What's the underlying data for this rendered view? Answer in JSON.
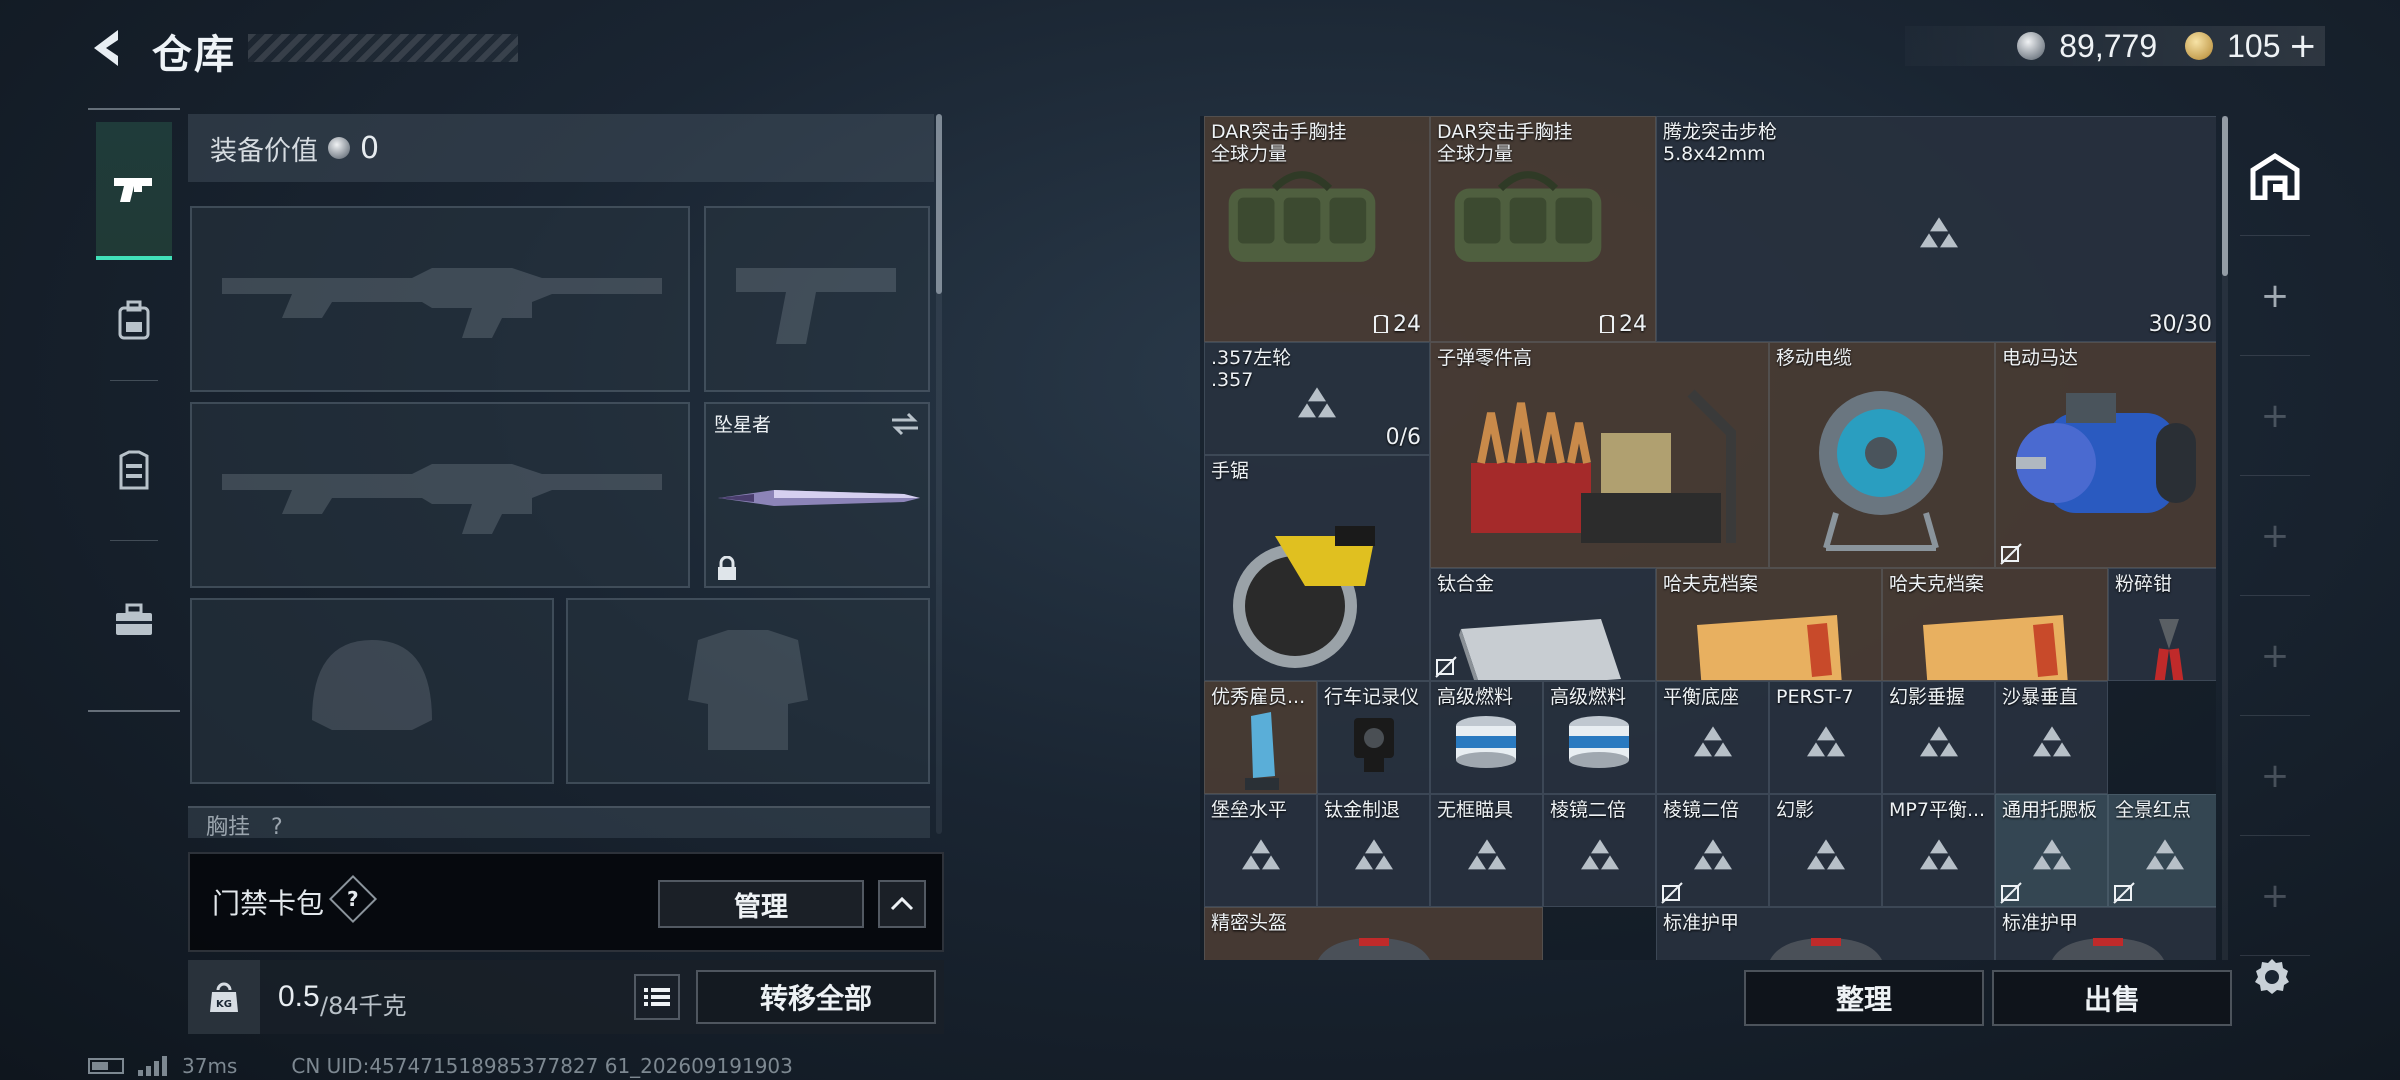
{
  "header": {
    "title": "仓库",
    "back_icon": "back-arrow-icon",
    "currency_silver": "89,779",
    "currency_gold": "105",
    "currency_plus": "+"
  },
  "left_nav": {
    "items": [
      {
        "icon": "pistol-icon",
        "active": true
      },
      {
        "icon": "backpack-icon",
        "active": false
      },
      {
        "icon": "vest-icon",
        "active": false
      },
      {
        "icon": "toolbox-icon",
        "active": false
      }
    ]
  },
  "loadout": {
    "equip_value_label": "装备价值",
    "equip_value": "0",
    "melee_name": "坠星者",
    "chest_rig_label": "胸挂",
    "chest_rig_count": "?"
  },
  "access_card": {
    "label": "门禁卡包",
    "help": "?",
    "manage": "管理"
  },
  "weight": {
    "current": "0.5",
    "max": "/84千克",
    "transfer_all": "转移全部"
  },
  "status": {
    "ping": "37ms",
    "uid": "CN UID:457471518985377827 61_202609191903"
  },
  "stash": {
    "items": [
      {
        "name": "DAR突击手胸挂\n全球力量",
        "count": "24",
        "bg": "brown",
        "art": "bag"
      },
      {
        "name": "DAR突击手胸挂\n全球力量",
        "count": "24",
        "bg": "brown",
        "art": "bag"
      },
      {
        "name": "腾龙突击步枪\n5.8x42mm",
        "count": "30/30",
        "bg": "dark",
        "art": "tri"
      },
      {
        "name": ".357左轮\n.357",
        "count": "0/6",
        "bg": "dark",
        "art": "tri"
      },
      {
        "name": "子弹零件高",
        "count": "",
        "bg": "brown",
        "art": "crate"
      },
      {
        "name": "移动电缆",
        "count": "",
        "bg": "brown",
        "art": "reel"
      },
      {
        "name": "电动马达",
        "count": "",
        "bg": "brown",
        "art": "motor"
      },
      {
        "name": "手锯",
        "count": "",
        "bg": "dark",
        "art": "saw"
      },
      {
        "name": "钛合金",
        "count": "",
        "bg": "dark",
        "art": "plate"
      },
      {
        "name": "哈夫克档案",
        "count": "",
        "bg": "brown",
        "art": "folder"
      },
      {
        "name": "哈夫克档案",
        "count": "",
        "bg": "brown",
        "art": "folder"
      },
      {
        "name": "粉碎钳",
        "count": "",
        "bg": "dark",
        "art": "cutter"
      },
      {
        "name": "优秀雇员...",
        "count": "",
        "bg": "brown",
        "art": "trophy"
      },
      {
        "name": "行车记录仪",
        "count": "",
        "bg": "dark",
        "art": "cam"
      },
      {
        "name": "高级燃料",
        "count": "",
        "bg": "dark",
        "art": "can"
      },
      {
        "name": "高级燃料",
        "count": "",
        "bg": "dark",
        "art": "can"
      },
      {
        "name": "平衡底座",
        "count": "",
        "bg": "dark",
        "art": "tri"
      },
      {
        "name": "PERST-7",
        "count": "",
        "bg": "dark",
        "art": "tri"
      },
      {
        "name": "幻影垂握",
        "count": "",
        "bg": "dark",
        "art": "tri"
      },
      {
        "name": "沙暴垂直",
        "count": "",
        "bg": "dark",
        "art": "tri"
      },
      {
        "name": "堡垒水平",
        "count": "",
        "bg": "dark",
        "art": "tri"
      },
      {
        "name": "钛金制退",
        "count": "",
        "bg": "dark",
        "art": "tri"
      },
      {
        "name": "无框瞄具",
        "count": "",
        "bg": "dark",
        "art": "tri"
      },
      {
        "name": "棱镜二倍",
        "count": "",
        "bg": "dark",
        "art": "tri"
      },
      {
        "name": "棱镜二倍",
        "count": "",
        "bg": "dark",
        "art": "tri"
      },
      {
        "name": "幻影",
        "count": "",
        "bg": "dark",
        "art": "tri"
      },
      {
        "name": "MP7平衡...",
        "count": "",
        "bg": "dark",
        "art": "tri"
      },
      {
        "name": "通用托腮板",
        "count": "",
        "bg": "teal",
        "art": "tri"
      },
      {
        "name": "全景红点",
        "count": "",
        "bg": "teal",
        "art": "tri"
      },
      {
        "name": "精密头盔",
        "count": "",
        "bg": "brown",
        "art": "helmet"
      },
      {
        "name": "标准护甲",
        "count": "",
        "bg": "dark",
        "art": "helmet"
      },
      {
        "name": "标准护甲",
        "count": "",
        "bg": "dark",
        "art": "helmet"
      }
    ]
  },
  "actions": {
    "sort": "整理",
    "sell": "出售"
  },
  "colors": {
    "accent": "#41e0b9",
    "panel": "#2c3442",
    "item_brown": "#4c3e34"
  }
}
